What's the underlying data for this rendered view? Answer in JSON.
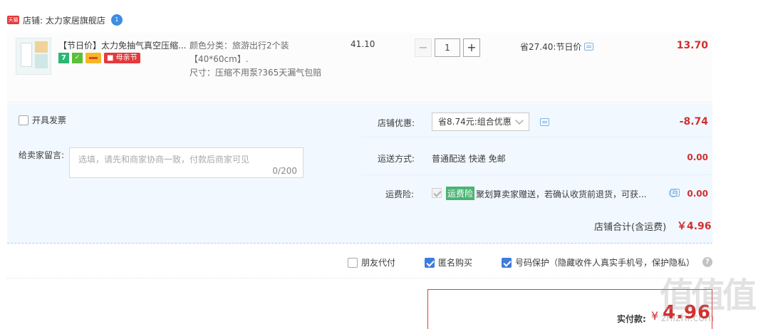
{
  "shop": {
    "name": "店铺: 太力家居旗舰店",
    "logo_text": "天猫",
    "ww_badge": "1"
  },
  "item": {
    "title": "【节日价】太力免抽气真空压缩...",
    "badges": {
      "seven": "7",
      "mom": "母亲节"
    },
    "sku_color": "颜色分类：旅游出行2个装【40*60cm】.",
    "sku_size": "尺寸：压缩不用泵?365天漏气包赔",
    "unit_price": "41.10",
    "qty_minus": "−",
    "qty": "1",
    "qty_plus": "+",
    "promo": "省27.40:节日价",
    "total": "13.70"
  },
  "options": {
    "invoice": "开具发票",
    "msg_label": "给卖家留言:",
    "msg_placeholder": "选填，请先和商家协商一致，付款后商家可见",
    "msg_count": "0/200",
    "shop_discount_label": "店铺优惠:",
    "shop_discount_select": "省8.74元:组合优惠",
    "shop_discount_amount": "-8.74",
    "shipping_label": "运送方式:",
    "shipping_value": "普通配送 快递 免邮",
    "shipping_amount": "0.00",
    "insurance_label": "运费险:",
    "insurance_badge": "运费险",
    "insurance_text": "聚划算卖家赠送，若确认收货前退货，可获...",
    "insurance_amount": "0.00",
    "shop_total_label": "店铺合计(含运费)",
    "shop_total_value": "￥4.96"
  },
  "checkout": {
    "friend_pay": "朋友代付",
    "anonymous": "匿名购买",
    "privacy": "号码保护（隐藏收件人真实手机号，保护隐私）",
    "help": "?",
    "pay_label": "实付款:",
    "pay_currency": "¥",
    "pay_value": "4.96"
  },
  "watermark": {
    "text": "值值值",
    "url": "zhizhi.com"
  },
  "colors": {
    "accent_red": "#d32f2f",
    "checkbox_blue": "#3e7cdd",
    "panel_bg": "#f1f8ff",
    "insurance_green": "#4ab472"
  }
}
